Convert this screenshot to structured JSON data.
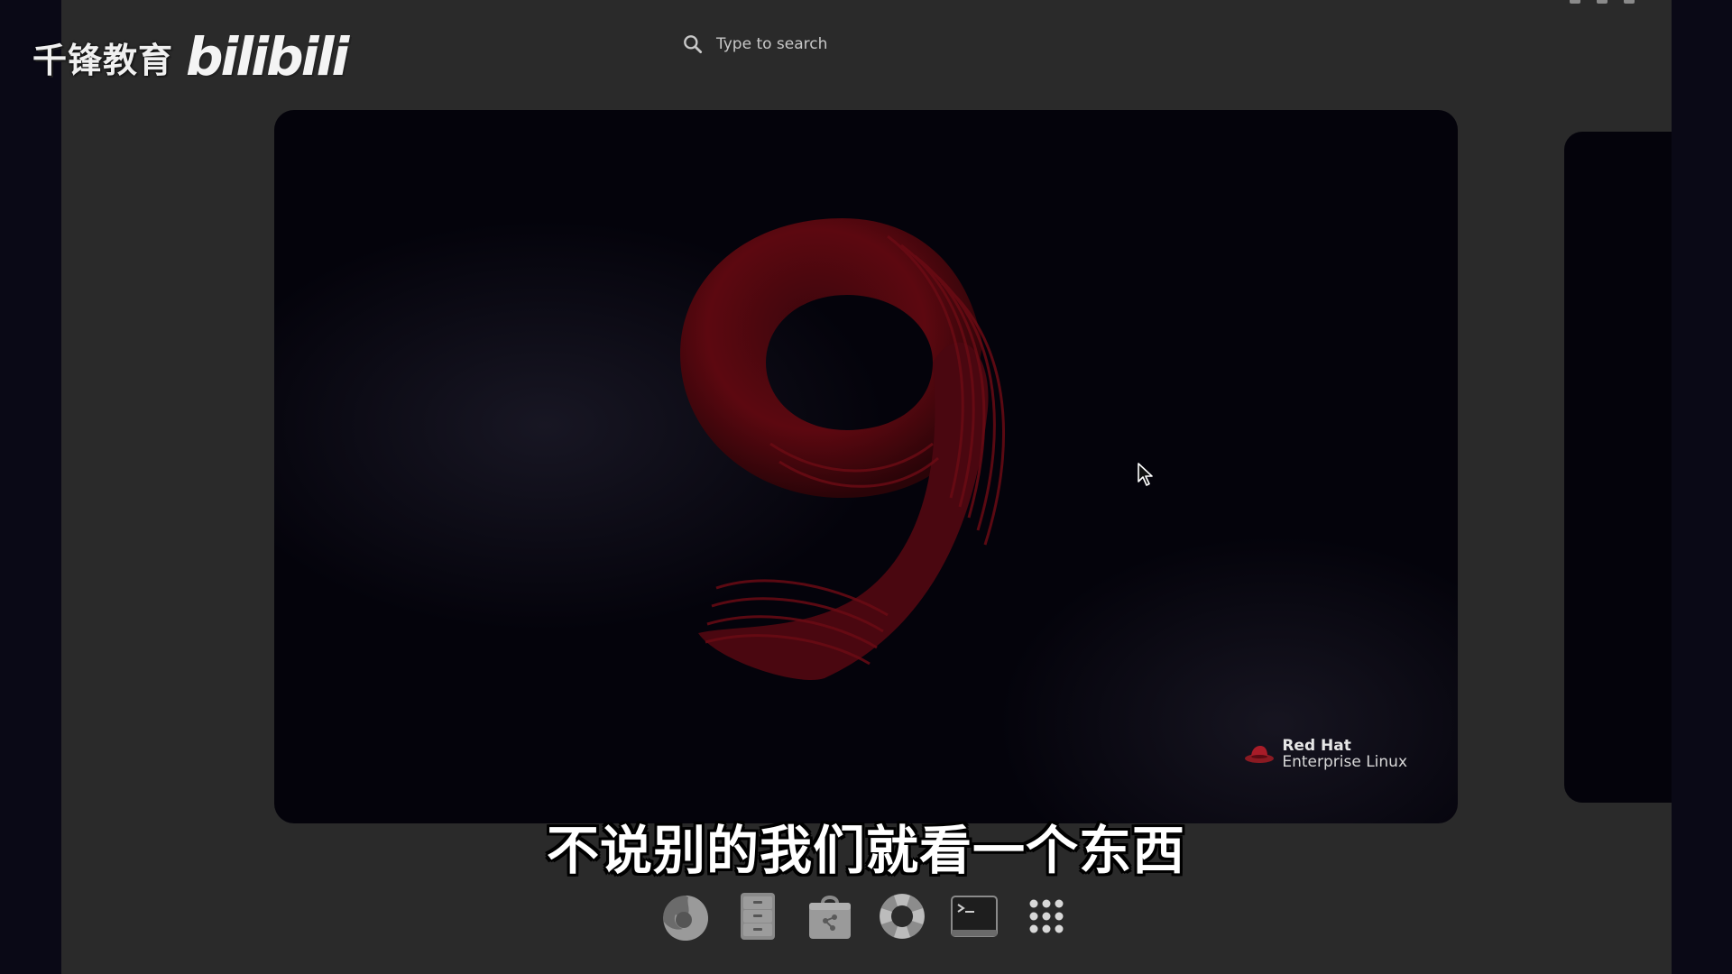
{
  "search": {
    "placeholder": "Type to search",
    "icon": "search-icon"
  },
  "workspace": {
    "wallpaper": {
      "numeral": "9",
      "logo_brand": "Red Hat",
      "logo_product": "Enterprise Linux"
    }
  },
  "dash": {
    "items": [
      {
        "name": "firefox",
        "icon": "firefox-icon"
      },
      {
        "name": "files",
        "icon": "file-cabinet-icon"
      },
      {
        "name": "software",
        "icon": "software-bag-icon"
      },
      {
        "name": "help",
        "icon": "lifebuoy-icon"
      },
      {
        "name": "terminal",
        "icon": "terminal-icon"
      },
      {
        "name": "show-applications",
        "icon": "app-grid-icon"
      }
    ]
  },
  "overlay": {
    "watermark_text": "千锋教育",
    "watermark_logo": "bilibili",
    "subtitle": "不说别的我们就看一个东西"
  },
  "colors": {
    "overview_bg": "#2a2a2a",
    "workspace_bg": "#04030b",
    "accent_red": "#7a0a12"
  }
}
